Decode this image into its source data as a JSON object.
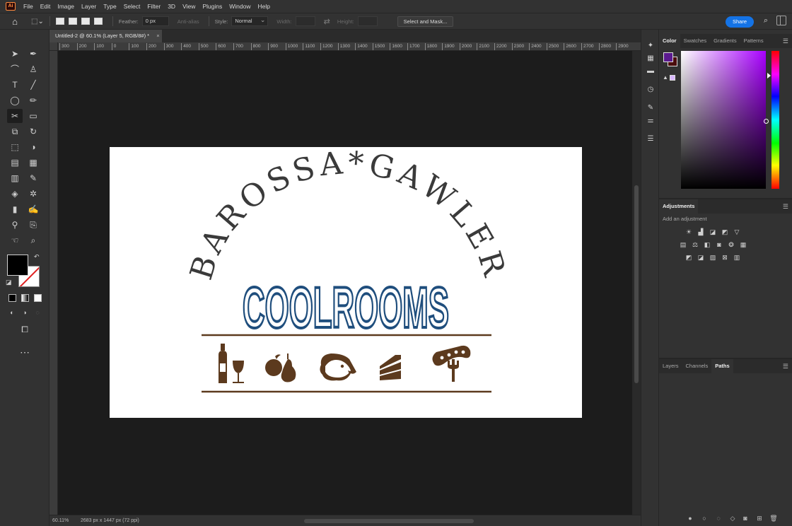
{
  "app": {
    "logo": "Ai",
    "menu": [
      "File",
      "Edit",
      "Image",
      "Layer",
      "Type",
      "Select",
      "Filter",
      "3D",
      "View",
      "Plugins",
      "Window",
      "Help"
    ]
  },
  "options": {
    "feather_label": "Feather:",
    "feather_value": "0 px",
    "antialias_label": "Anti-alias",
    "style_label": "Style:",
    "style_value": "Normal",
    "width_label": "Width:",
    "height_label": "Height:",
    "select_mask_label": "Select and Mask...",
    "share_label": "Share"
  },
  "document": {
    "tab_title": "Untitled-2 @ 60.1% (Layer 5, RGB/8#) *",
    "close_glyph": "×"
  },
  "ruler": {
    "ticks": [
      "300",
      "200",
      "100",
      "0",
      "100",
      "200",
      "300",
      "400",
      "500",
      "600",
      "700",
      "800",
      "900",
      "1000",
      "1100",
      "1200",
      "1300",
      "1400",
      "1500",
      "1600",
      "1700",
      "1800",
      "1900",
      "2000",
      "2100",
      "2200",
      "2300",
      "2400",
      "2500",
      "2600",
      "2700",
      "2800",
      "2900"
    ]
  },
  "artwork": {
    "arc_text": "BAROSSA*GAWLER",
    "headline": "COOLROOMS",
    "headline_color": "#1f4e7d",
    "arc_color": "#3a3a3a",
    "accent_color": "#5c3a1e",
    "icons": [
      "wine-bottle-glass-icon",
      "apple-pear-icon",
      "sheep-icon",
      "cake-slice-icon",
      "sausage-fork-icon"
    ]
  },
  "status": {
    "zoom": "60.11%",
    "doc_info": "2683 px x 1447 px (72 ppi)"
  },
  "panels": {
    "color_tabs": [
      "Color",
      "Swatches",
      "Gradients",
      "Patterns"
    ],
    "fg_color": "#5b1a8f",
    "bg_color": "#4a0d0d",
    "adjustments_title": "Adjustments",
    "adjustments_hint": "Add an adjustment",
    "layer_tabs": [
      "Layers",
      "Channels",
      "Paths"
    ]
  }
}
